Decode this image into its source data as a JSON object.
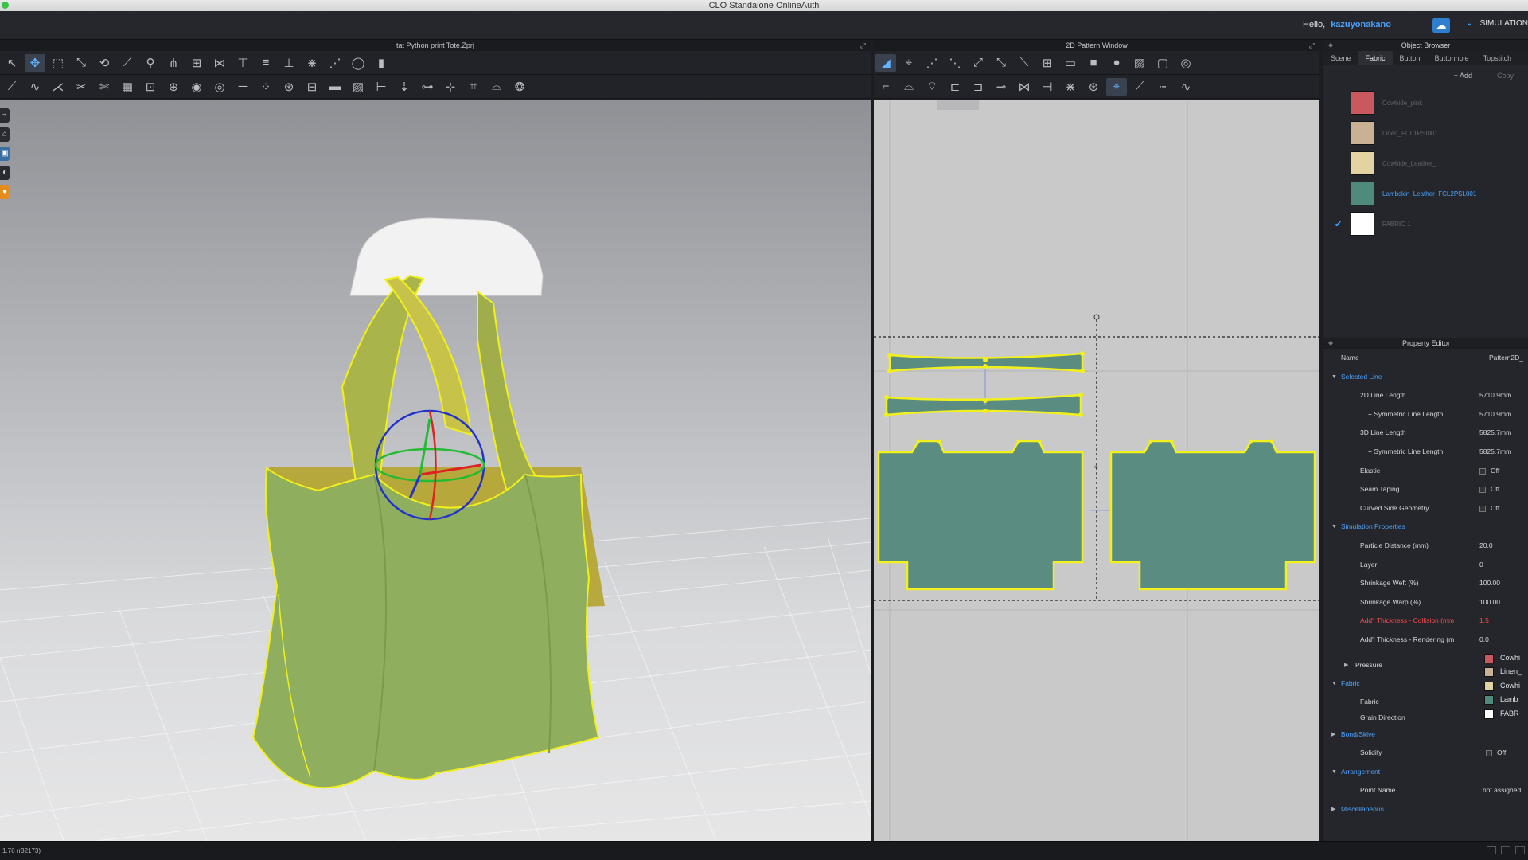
{
  "window": {
    "title": "CLO Standalone OnlineAuth"
  },
  "header": {
    "greeting": "Hello,",
    "username": "kazuyonakano",
    "mode": "SIMULATION"
  },
  "window_3d": {
    "title": "tat Python print Tote.Zprj"
  },
  "window_2d": {
    "title": "2D Pattern Window"
  },
  "object_browser": {
    "title": "Object Browser",
    "tabs": [
      "Scene",
      "Fabric",
      "Button",
      "Buttonhole",
      "Topstitch"
    ],
    "active_tab": "Fabric",
    "add_label": "+ Add",
    "copy_label": "Copy",
    "fabrics": [
      {
        "name": "Cowhide_pink",
        "color": "#c9585f",
        "checked": false,
        "active": false
      },
      {
        "name": "Linen_FCL1PSI001",
        "color": "#c9b294",
        "checked": false,
        "active": false
      },
      {
        "name": "Cowhide_Leather_",
        "color": "#e3d3a2",
        "checked": false,
        "active": false
      },
      {
        "name": "Lambskin_Leather_FCL2PSL001",
        "color": "#4f8a7e",
        "checked": false,
        "active": true
      },
      {
        "name": "FABRIC 1",
        "color": "#ffffff",
        "checked": true,
        "active": false
      }
    ]
  },
  "property_editor": {
    "title": "Property Editor",
    "name_label": "Name",
    "name_value": "Pattern2D_",
    "sections": {
      "selected_line": "Selected Line",
      "simulation_properties": "Simulation Properties",
      "pressure": "Pressure",
      "fabric": "Fabric",
      "bond_skive": "Bond/Skive",
      "arrangement": "Arrangement",
      "miscellaneous": "Miscellaneous"
    },
    "rows": {
      "line_2d_label": "2D Line Length",
      "line_2d_value": "5710.9mm",
      "sym_2d_label": "+ Symmetric Line Length",
      "sym_2d_value": "5710.9mm",
      "line_3d_label": "3D Line Length",
      "line_3d_value": "5825.7mm",
      "sym_3d_label": "+ Symmetric Line Length",
      "sym_3d_value": "5825.7mm",
      "elastic_label": "Elastic",
      "elastic_value": "Off",
      "seam_taping_label": "Seam Taping",
      "seam_taping_value": "Off",
      "curved_label": "Curved Side Geometry",
      "curved_value": "Off",
      "particle_label": "Particle Distance (mm)",
      "particle_value": "20.0",
      "layer_label": "Layer",
      "layer_value": "0",
      "weft_label": "Shrinkage Weft (%)",
      "weft_value": "100.00",
      "warp_label": "Shrinkage Warp (%)",
      "warp_value": "100.00",
      "collision_label": "Add'l Thickness - Collision (mm",
      "collision_value": "1.5",
      "rendering_label": "Add'l Thickness - Rendering (m",
      "rendering_value": "0.0",
      "fabric_label": "Fabric",
      "grain_label": "Grain Direction",
      "solidify_label": "Solidify",
      "solidify_value": "Off",
      "point_name_label": "Point Name",
      "point_name_value": "not assigned"
    },
    "fabric_swatches": [
      {
        "name": "Cowhi",
        "color": "#c9585f"
      },
      {
        "name": "Linen_",
        "color": "#c9b294"
      },
      {
        "name": "Cowhi",
        "color": "#e3d3a2"
      },
      {
        "name": "Lamb",
        "color": "#4f8a7e"
      },
      {
        "name": "FABR",
        "color": "#ffffff"
      }
    ]
  },
  "status": {
    "text": "1.76 (r32173)"
  },
  "colors": {
    "accent": "#4aa3ff",
    "bag_green": "#8fae5e",
    "pattern_fill": "#5b8c82",
    "highlight": "#f2f01c"
  }
}
